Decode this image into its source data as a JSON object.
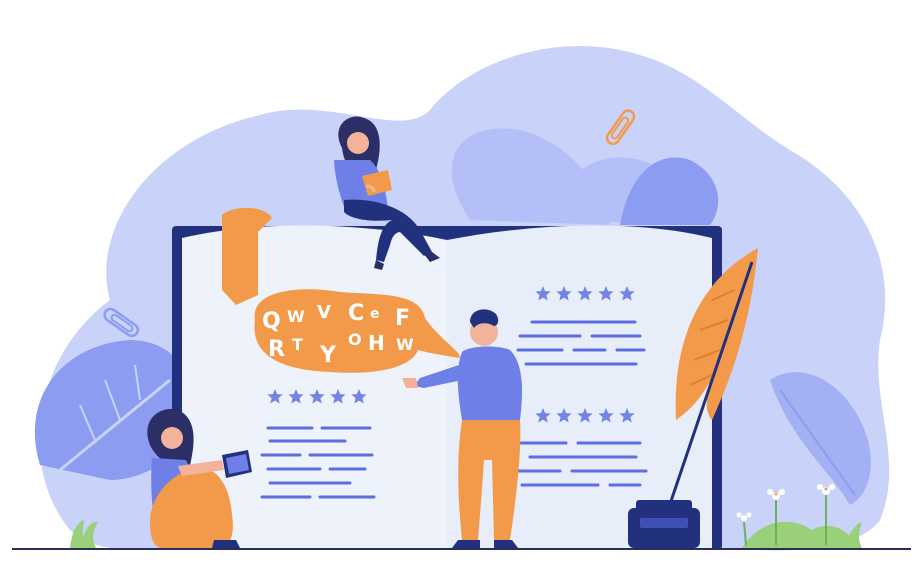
{
  "illustration": {
    "bubble_letters": [
      "Q",
      "W",
      "V",
      "C",
      "e",
      "F",
      "R",
      "T",
      "Y",
      "O",
      "H",
      "W"
    ],
    "star_rows": [
      {
        "label": "left-page-rating",
        "stars": 5
      },
      {
        "label": "right-page-top-rating",
        "stars": 5
      },
      {
        "label": "right-page-bottom-rating",
        "stars": 5
      }
    ],
    "colors": {
      "blob_background": "#c9d2f9",
      "blob_leaves": "#8c9cf0",
      "book_cover": "#22317e",
      "book_page": "#eef2fb",
      "accent_orange": "#f29a4a",
      "star_blue": "#7383e6",
      "text_lines": "#5b6ee2",
      "person_shirt": "#6e7fe8",
      "person_hair": "#2b2f66",
      "ground": "#2a2f55"
    }
  }
}
